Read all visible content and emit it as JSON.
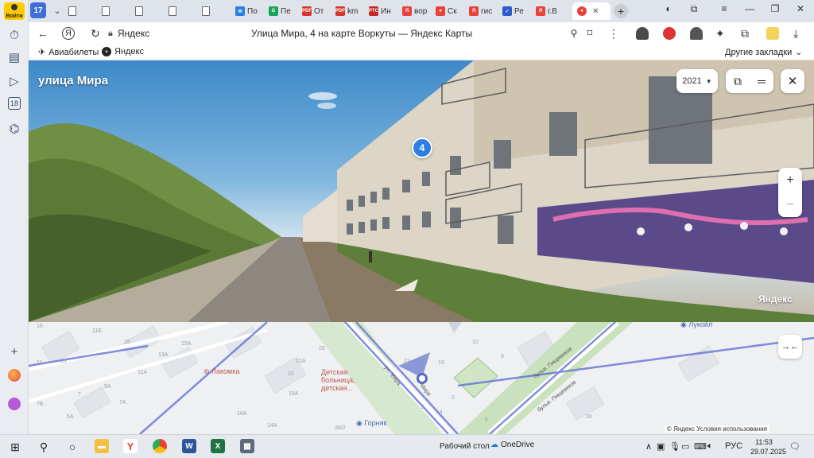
{
  "sidebar": {
    "login_label": "Войти",
    "items": [
      {
        "icon": "history-icon",
        "glyph": "⏱"
      },
      {
        "icon": "collections-icon",
        "glyph": "▤"
      },
      {
        "icon": "video-icon",
        "glyph": "▶"
      },
      {
        "icon": "age-rating-icon",
        "glyph": "18"
      },
      {
        "icon": "screenshot-icon",
        "glyph": "⌬"
      },
      {
        "icon": "add-panel-icon",
        "glyph": "+"
      },
      {
        "icon": "alice-icon",
        "glyph": "●"
      },
      {
        "icon": "messenger-icon",
        "glyph": "●"
      }
    ]
  },
  "tabs": {
    "count": "17",
    "items": [
      {
        "label": "",
        "fav_color": "#ffffff",
        "fav_text": "",
        "doc": true
      },
      {
        "label": "",
        "fav_color": "#ffffff",
        "fav_text": "",
        "doc": true
      },
      {
        "label": "",
        "fav_color": "#ffffff",
        "fav_text": "",
        "doc": true
      },
      {
        "label": "",
        "fav_color": "#ffffff",
        "fav_text": "",
        "doc": true
      },
      {
        "label": "",
        "fav_color": "#ffffff",
        "fav_text": "",
        "doc": true
      },
      {
        "label": "По",
        "fav_color": "#2a7de1",
        "fav_text": "✉"
      },
      {
        "label": "Пе",
        "fav_color": "#1ba45a",
        "fav_text": "G"
      },
      {
        "label": "От",
        "fav_color": "#d9342b",
        "fav_text": "PDF"
      },
      {
        "label": "km",
        "fav_color": "#d9342b",
        "fav_text": "PDF"
      },
      {
        "label": "Ин",
        "fav_color": "#c62828",
        "fav_text": "PTC"
      },
      {
        "label": "вор",
        "fav_color": "#e8423a",
        "fav_text": "Я"
      },
      {
        "label": "Ск",
        "fav_color": "#e8423a",
        "fav_text": "●"
      },
      {
        "label": "гис",
        "fav_color": "#e8423a",
        "fav_text": "Я"
      },
      {
        "label": "Ре",
        "fav_color": "#2a5ec9",
        "fav_text": "✓"
      },
      {
        "label": "г.В",
        "fav_color": "#e8423a",
        "fav_text": "Я"
      }
    ],
    "active_fav_color": "#e8423a"
  },
  "toolbar": {
    "domain": "Яндекс",
    "page_title": "Улица Мира, 4 на карте Воркуты — Яндекс Карты"
  },
  "bookmarks": {
    "items": [
      "Авиабилеты",
      "Яндекс"
    ],
    "other": "Другие закладки"
  },
  "panorama": {
    "street_name": "улица Мира",
    "year": "2021",
    "house_number": "4",
    "watermark": "Яндекс"
  },
  "map": {
    "pois": [
      {
        "label": "Лакомка",
        "style": "red"
      },
      {
        "label": "Детская\nбольница,\nдетская...",
        "style": "red"
      },
      {
        "label": "Горняк",
        "style": "blue"
      },
      {
        "label": "Лукойл",
        "style": "blue"
      }
    ],
    "streets": [
      "ул. Мира",
      "Мира",
      "бульв. Пищевиков",
      "бульв. Пищевиков"
    ],
    "house_labels": [
      "16",
      "11Б",
      "15А",
      "15",
      "11",
      "13А",
      "13",
      "11А",
      "9А",
      "7",
      "7А",
      "5А",
      "7Б",
      "14А",
      "20",
      "22А",
      "22",
      "18А",
      "16А",
      "14",
      "12",
      "10",
      "8",
      "2",
      "3",
      "4",
      "6",
      "21",
      "19",
      "26",
      "38/2"
    ],
    "copyright": "© Яндекс   Условия использования"
  },
  "taskbar": {
    "desktop_label": "Рабочий стол",
    "onedrive_label": "OneDrive",
    "lang": "РУС",
    "time": "11:53",
    "date": "29.07.2025"
  }
}
